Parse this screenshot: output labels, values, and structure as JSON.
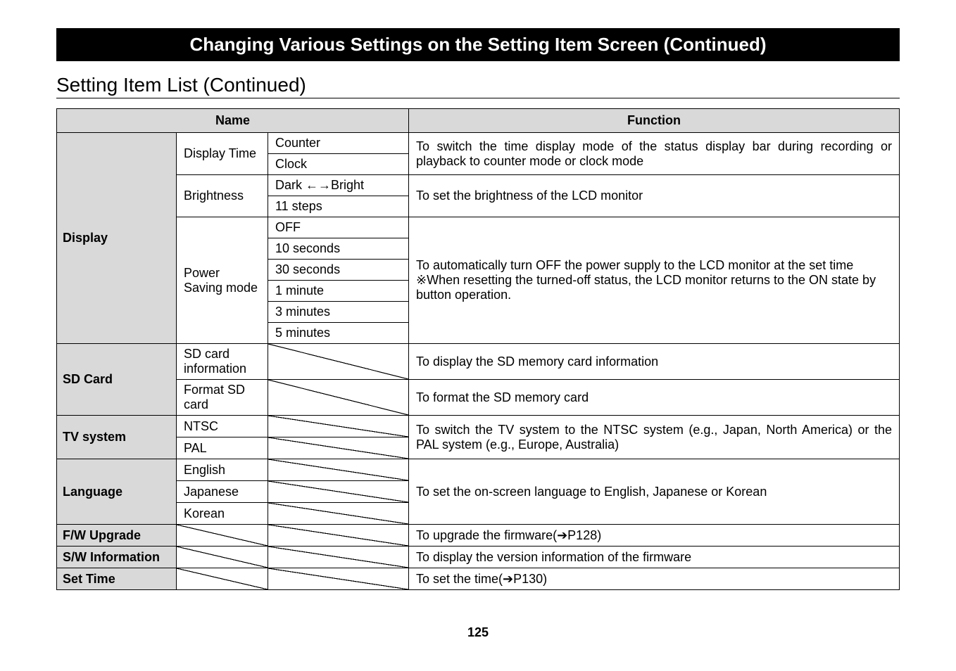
{
  "header": {
    "title": "Changing Various Settings on the Setting Item Screen (Continued)",
    "subtitle": "Setting Item List (Continued)"
  },
  "columns": {
    "name": "Name",
    "function": "Function"
  },
  "display": {
    "cat": "Display",
    "displayTime": {
      "label": "Display Time",
      "counter": "Counter",
      "clock": "Clock",
      "fn": "To switch the time display mode of the status display bar during recording or playback to counter mode or clock mode"
    },
    "brightness": {
      "label": "Brightness",
      "dark": "Dark ←→Bright",
      "steps": "11 steps",
      "fn": "To set the brightness of the LCD monitor"
    },
    "powerSaving": {
      "label": "Power Saving mode",
      "off": "OFF",
      "s10": "10 seconds",
      "s30": "30 seconds",
      "m1": "1 minute",
      "m3": "3 minutes",
      "m5": "5 minutes",
      "fn": "To automatically turn OFF the power supply to the LCD monitor at the set time\n※When resetting the turned-off status, the LCD monitor returns to the ON state by button operation."
    }
  },
  "sdCard": {
    "cat": "SD Card",
    "info": {
      "label": "SD card information",
      "fn": "To display the SD memory card information"
    },
    "format": {
      "label": "Format SD card",
      "fn": "To format the SD memory card"
    }
  },
  "tv": {
    "cat": "TV system",
    "ntsc": "NTSC",
    "pal": "PAL",
    "fn": "To switch the TV system to the NTSC system (e.g., Japan, North America) or the PAL system (e.g., Europe, Australia)"
  },
  "lang": {
    "cat": "Language",
    "english": "English",
    "japanese": "Japanese",
    "korean": "Korean",
    "fn": "To set the on-screen language to English, Japanese or Korean"
  },
  "fw": {
    "cat": "F/W Upgrade",
    "fn": "To upgrade the firmware(➔P128)"
  },
  "sw": {
    "cat": "S/W Information",
    "fn": "To display the version information of the firmware"
  },
  "setTime": {
    "cat": "Set Time",
    "fn": "To set the time(➔P130)"
  },
  "pageNumber": "125"
}
